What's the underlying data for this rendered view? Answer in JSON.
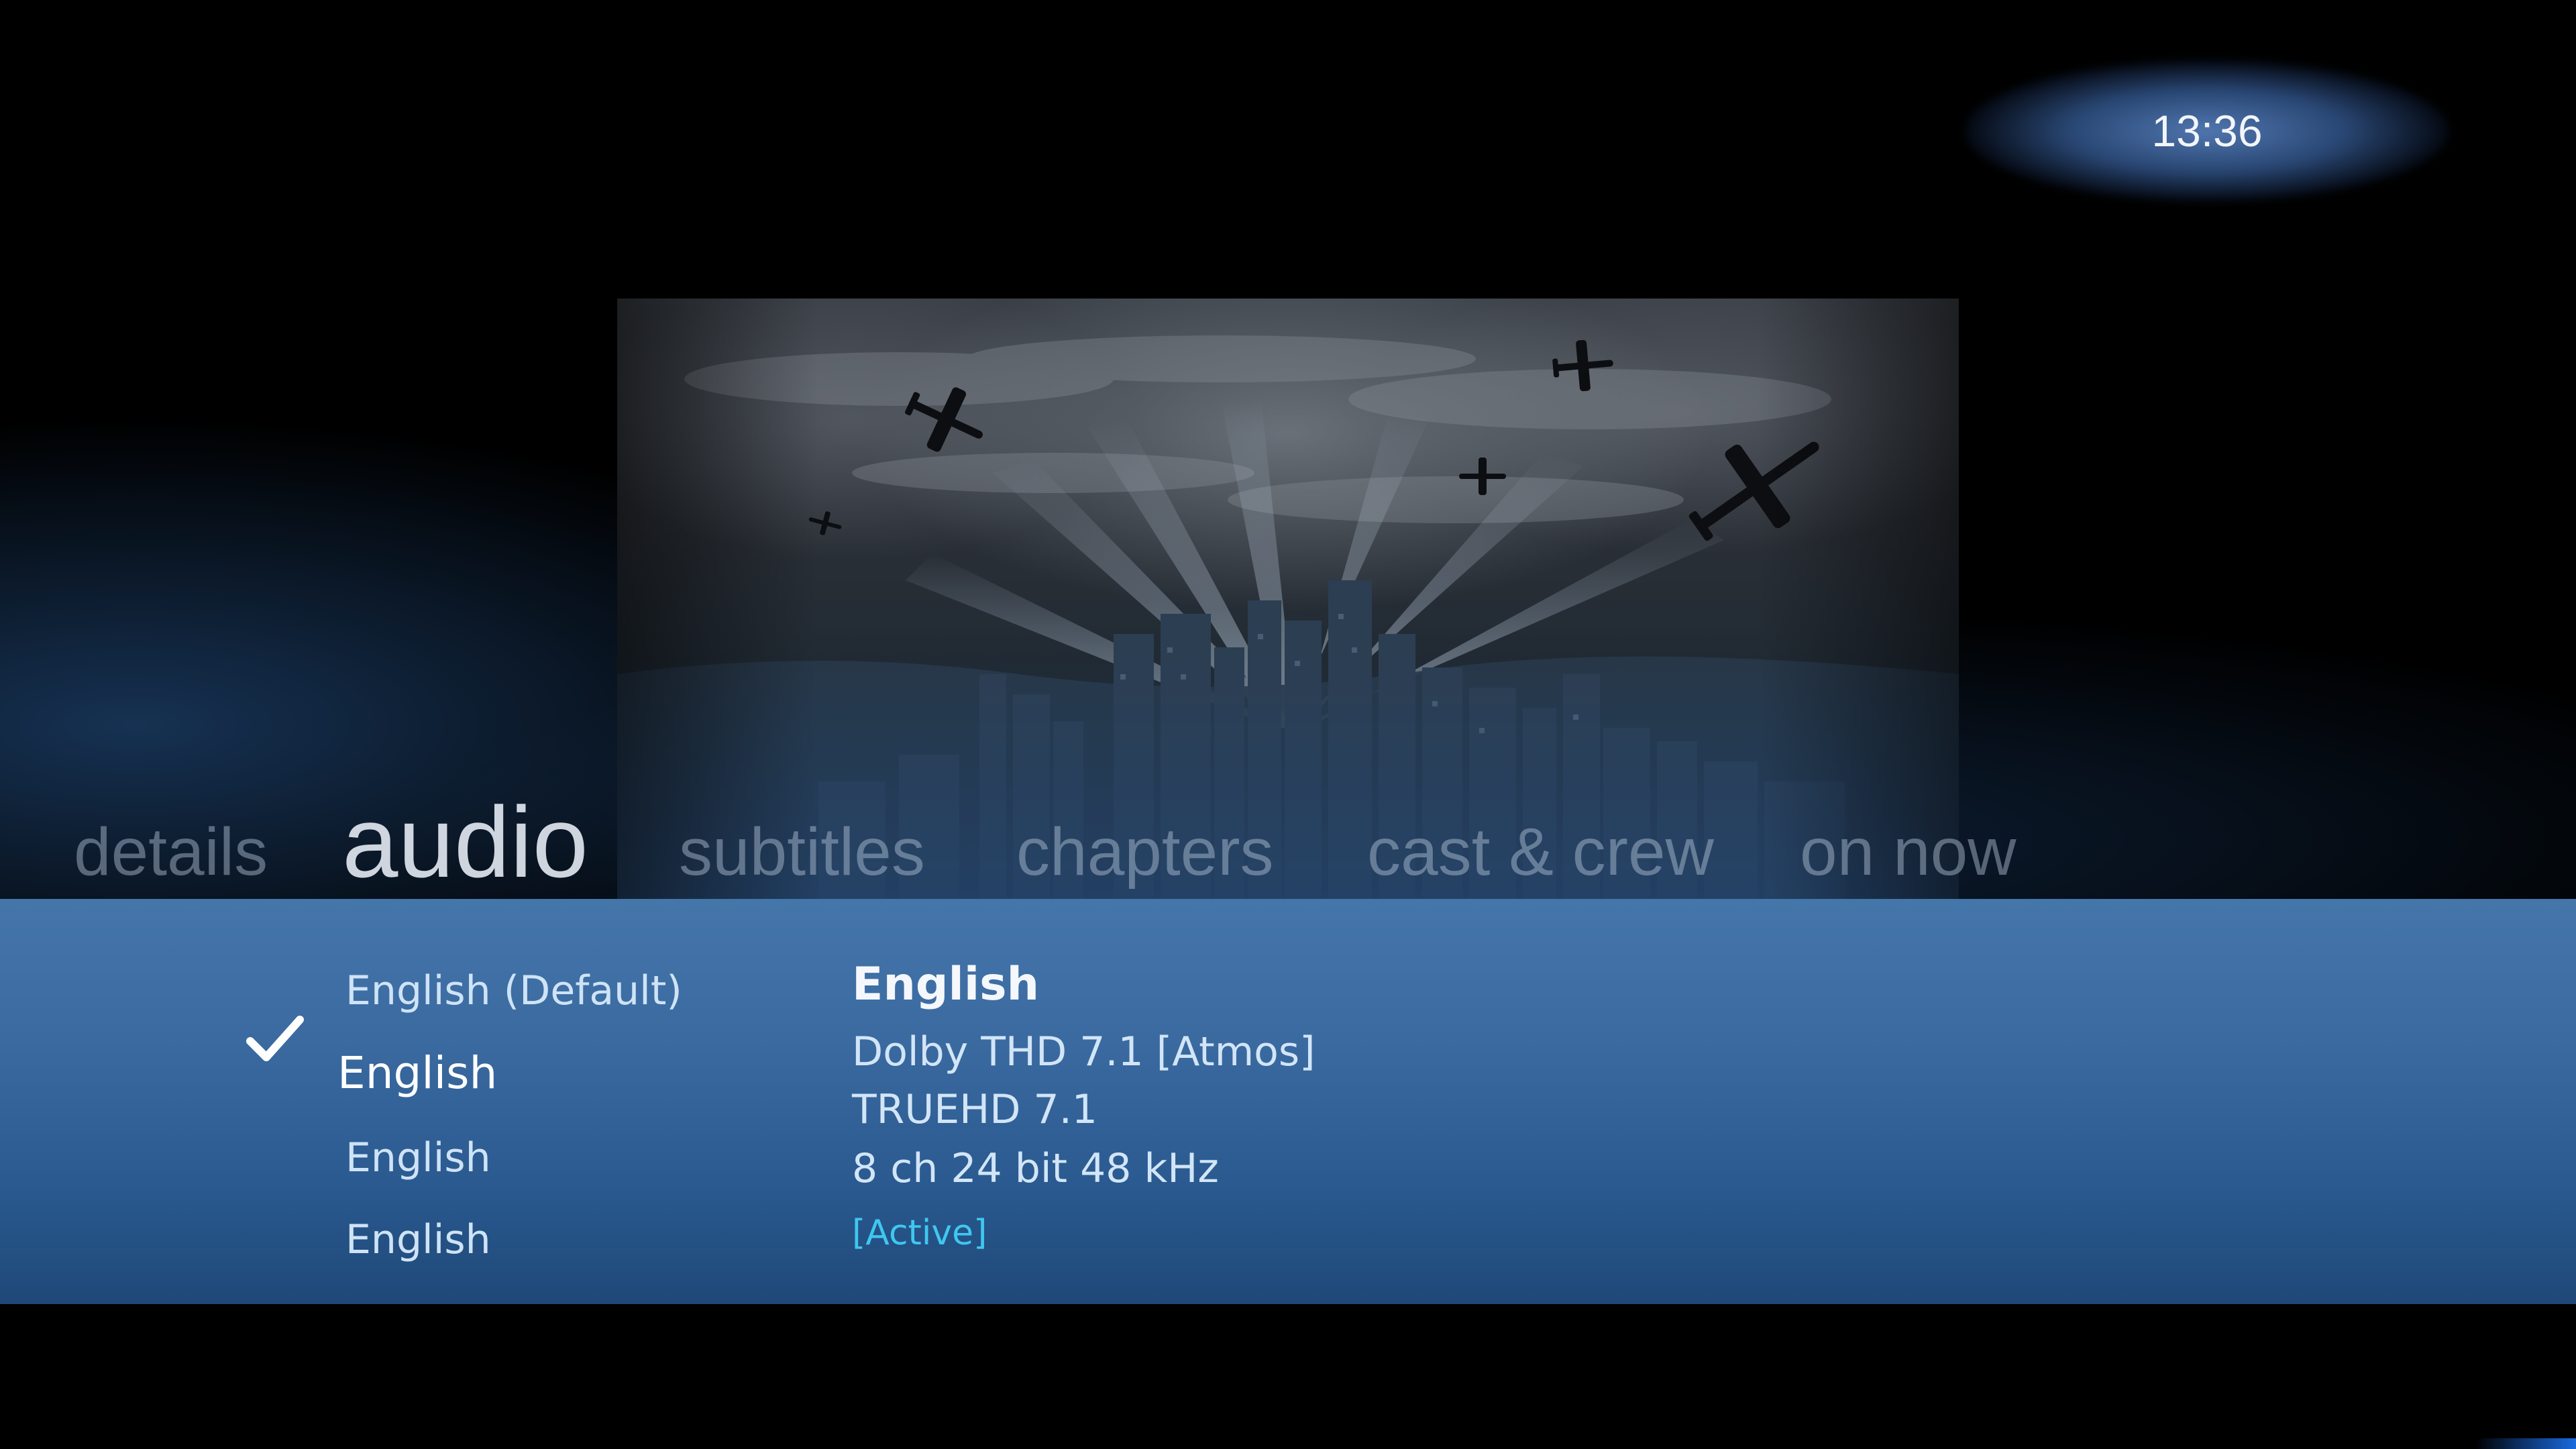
{
  "clock": {
    "time": "13:36"
  },
  "artwork": {
    "icon": "film-artwork-city-searchlights-bombers"
  },
  "tabs": [
    {
      "label": "details",
      "active": false
    },
    {
      "label": "audio",
      "active": true
    },
    {
      "label": "subtitles",
      "active": false
    },
    {
      "label": "chapters",
      "active": false
    },
    {
      "label": "cast & crew",
      "active": false
    },
    {
      "label": "on now",
      "active": false
    }
  ],
  "audio_tracks": [
    {
      "label": "English (Default)",
      "selected": false
    },
    {
      "label": "English",
      "selected": true
    },
    {
      "label": "English",
      "selected": false
    },
    {
      "label": "English",
      "selected": false
    }
  ],
  "selected_icon": "checkmark-icon",
  "track_details": {
    "title": "English",
    "codec": "Dolby THD 7.1 [Atmos]",
    "format": "TRUEHD 7.1",
    "specs": "8 ch  24 bit  48 kHz",
    "status": "[Active]"
  },
  "colors": {
    "panel": "#3a6aa0",
    "status_accent": "#3fc7f0",
    "clock_glow": "#557db9"
  }
}
